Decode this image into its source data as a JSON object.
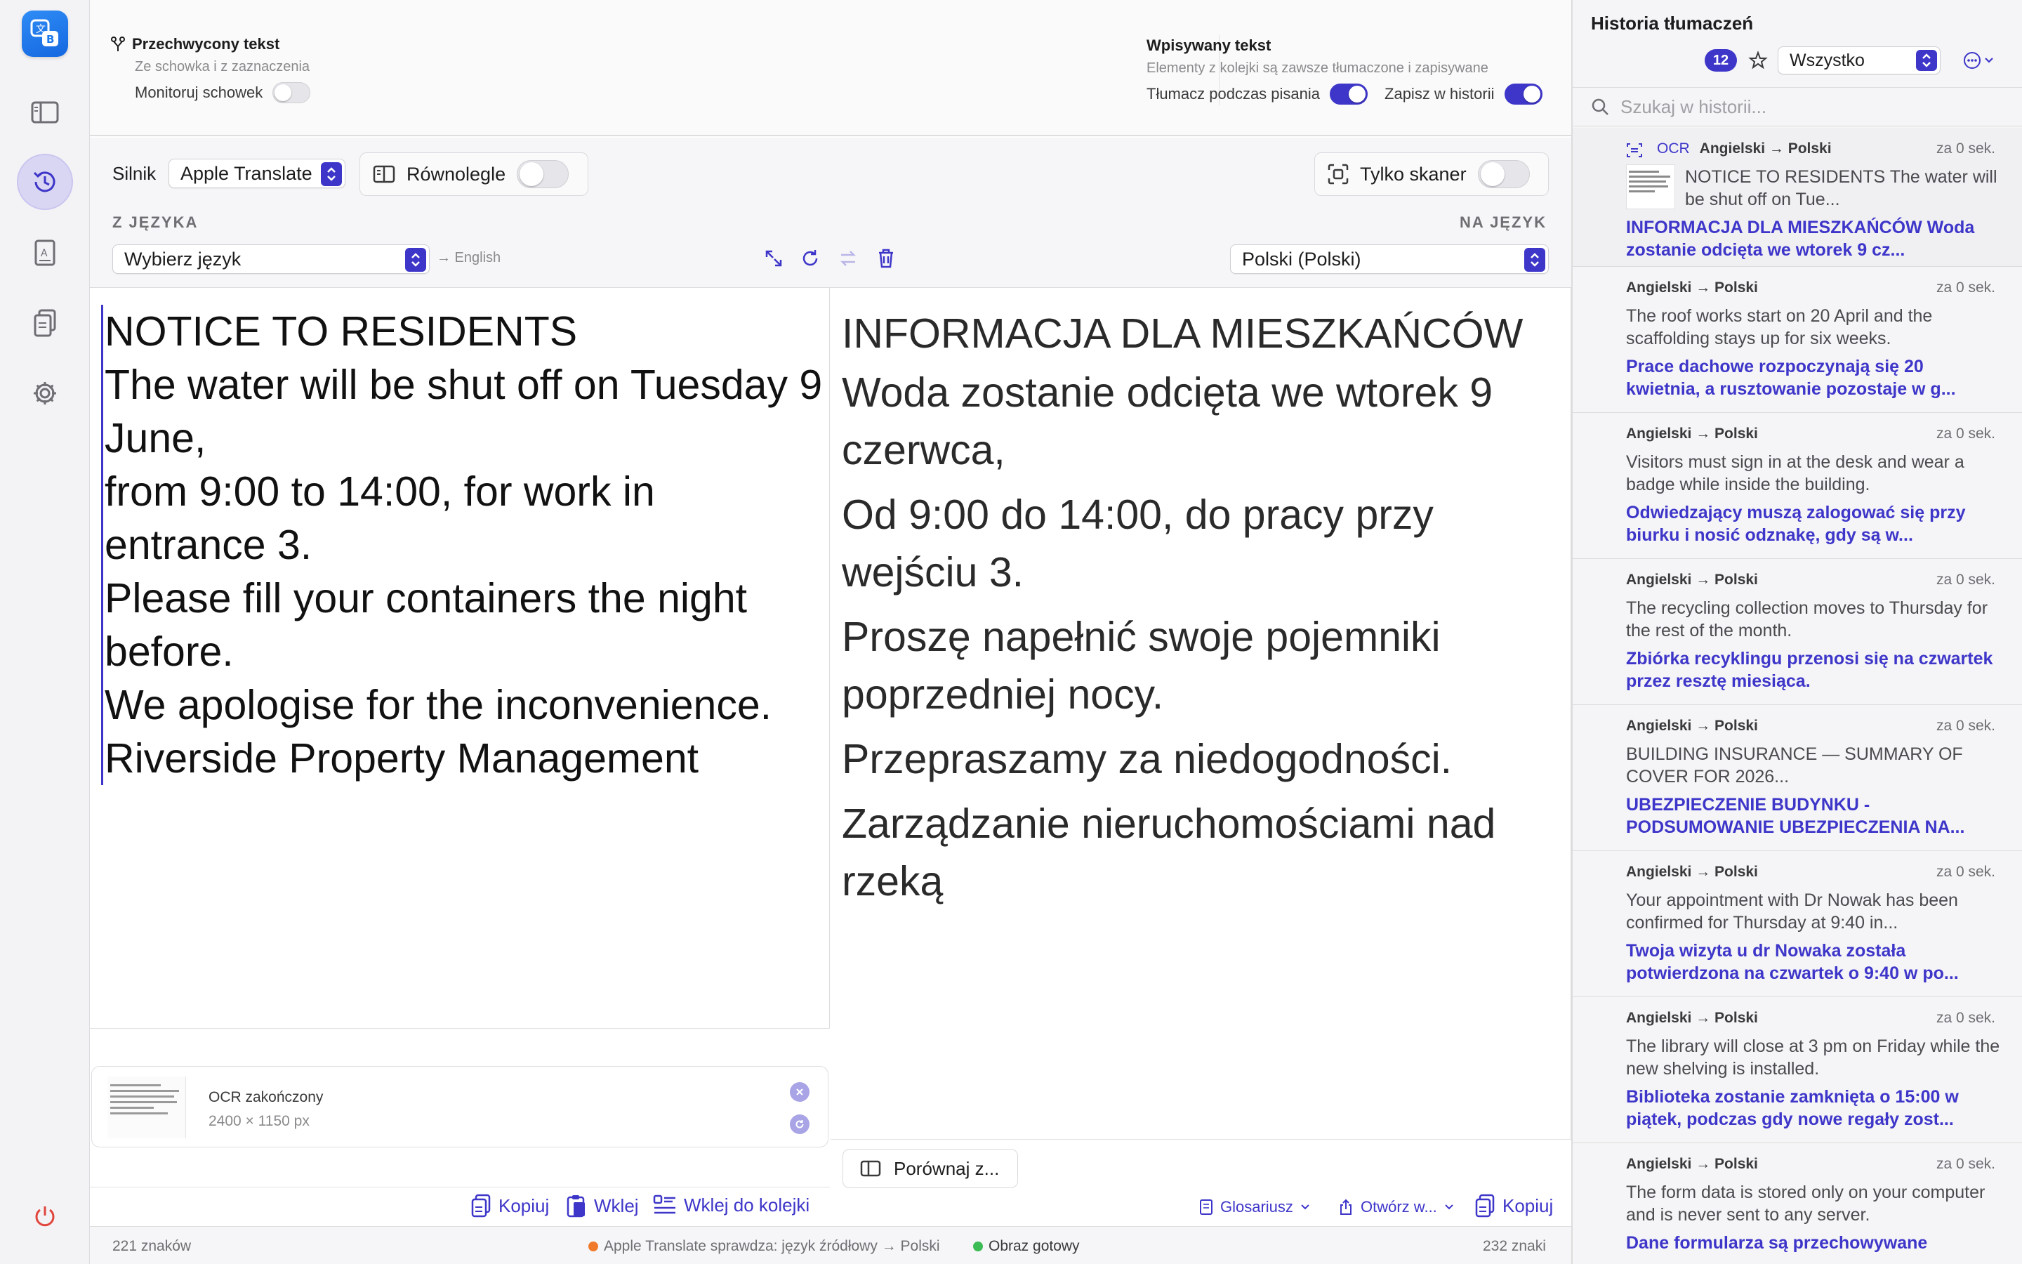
{
  "rail": {
    "items": [
      "sidebar-toggle",
      "history",
      "dictionary",
      "documents",
      "settings",
      "power"
    ]
  },
  "capture": {
    "title": "Przechwycony tekst",
    "subtitle": "Ze schowka i z zaznaczenia",
    "monitor_label": "Monitoruj schowek",
    "monitor_on": false
  },
  "typed": {
    "title": "Wpisywany tekst",
    "subtitle": "Elementy z kolejki są zawsze tłumaczone i zapisywane",
    "translate_label": "Tłumacz podczas pisania",
    "translate_on": true,
    "save_label": "Zapisz w historii",
    "save_on": true
  },
  "controls": {
    "engine_label": "Silnik",
    "engine_value": "Apple Translate",
    "parallel_label": "Równolegle",
    "parallel_on": false,
    "scanner_label": "Tylko skaner",
    "scanner_on": false,
    "from_label": "Z JĘZYKA",
    "from_value": "Wybierz język",
    "detected": "→ English",
    "to_label": "NA JĘZYK",
    "to_value": "Polski (Polski)"
  },
  "source": {
    "lines": [
      "NOTICE TO RESIDENTS",
      "The water will be shut off on Tuesday 9 June,",
      "from 9:00 to 14:00, for work in entrance 3.",
      "Please fill your containers the night before.",
      "We apologise for the inconvenience.",
      "Riverside Property Management"
    ]
  },
  "target": {
    "lines": [
      "INFORMACJA DLA MIESZKAŃCÓW",
      "Woda zostanie odcięta we wtorek 9 czerwca,",
      "Od 9:00 do 14:00, do pracy przy wejściu 3.",
      "Proszę napełnić swoje pojemniki poprzedniej nocy.",
      "Przepraszamy za niedogodności.",
      "Zarządzanie nieruchomościami nad rzeką"
    ]
  },
  "ocr": {
    "status": "OCR zakończony",
    "size": "2400 × 1150 px"
  },
  "left_actions": {
    "copy": "Kopiuj",
    "paste": "Wklej",
    "paste_queue": "Wklej do kolejki"
  },
  "right_actions": {
    "compare": "Porównaj z...",
    "glossary": "Glosariusz",
    "open": "Otwórz w...",
    "copy": "Kopiuj"
  },
  "status": {
    "left_count": "221 znaków",
    "engine_status": "Apple Translate sprawdza: język źródłowy → Polski",
    "engine_color": "#f07a2a",
    "image_status": "Obraz gotowy",
    "image_color": "#3dbb55",
    "right_count": "232 znaki"
  },
  "history": {
    "title": "Historia tłumaczeń",
    "count": "12",
    "filter": "Wszystko",
    "search_placeholder": "Szukaj w historii...",
    "items": [
      {
        "ocr": "OCR",
        "langs": "Angielski → Polski",
        "when": "za 0 sek.",
        "src": "NOTICE TO RESIDENTS The water will be shut off on Tue...",
        "tgt": "INFORMACJA DLA MIESZKAŃCÓW Woda zostanie odcięta we wtorek 9 cz..."
      },
      {
        "ocr": "",
        "langs": "Angielski → Polski",
        "when": "za 0 sek.",
        "src": "The roof works start on 20 April and the scaffolding stays up for six weeks.",
        "tgt": "Prace dachowe rozpoczynają się 20 kwietnia, a rusztowanie pozostaje w g..."
      },
      {
        "ocr": "",
        "langs": "Angielski → Polski",
        "when": "za 0 sek.",
        "src": "Visitors must sign in at the desk and wear a badge while inside the building.",
        "tgt": "Odwiedzający muszą zalogować się przy biurku i nosić odznakę, gdy są w..."
      },
      {
        "ocr": "",
        "langs": "Angielski → Polski",
        "when": "za 0 sek.",
        "src": "The recycling collection moves to Thursday for the rest of the month.",
        "tgt": "Zbiórka recyklingu przenosi się na czwartek przez resztę miesiąca."
      },
      {
        "ocr": "",
        "langs": "Angielski → Polski",
        "when": "za 0 sek.",
        "src": "BUILDING INSURANCE — SUMMARY OF COVER FOR 2026...",
        "tgt": "UBEZPIECZENIE BUDYNKU - PODSUMOWANIE UBEZPIECZENIA NA..."
      },
      {
        "ocr": "",
        "langs": "Angielski → Polski",
        "when": "za 0 sek.",
        "src": "Your appointment with Dr Nowak has been confirmed for Thursday at 9:40 in...",
        "tgt": "Twoja wizyta u dr Nowaka została potwierdzona na czwartek o 9:40 w po..."
      },
      {
        "ocr": "",
        "langs": "Angielski → Polski",
        "when": "za 0 sek.",
        "src": "The library will close at 3 pm on Friday while the new shelving is installed.",
        "tgt": "Biblioteka zostanie zamknięta o 15:00 w piątek, podczas gdy nowe regały zost..."
      },
      {
        "ocr": "",
        "langs": "Angielski → Polski",
        "when": "za 0 sek.",
        "src": "The form data is stored only on your computer and is never sent to any server.",
        "tgt": "Dane formularza są przechowywane"
      }
    ]
  },
  "colors": {
    "accent": "#3e36c9",
    "app_icon": "#1b78ea"
  }
}
